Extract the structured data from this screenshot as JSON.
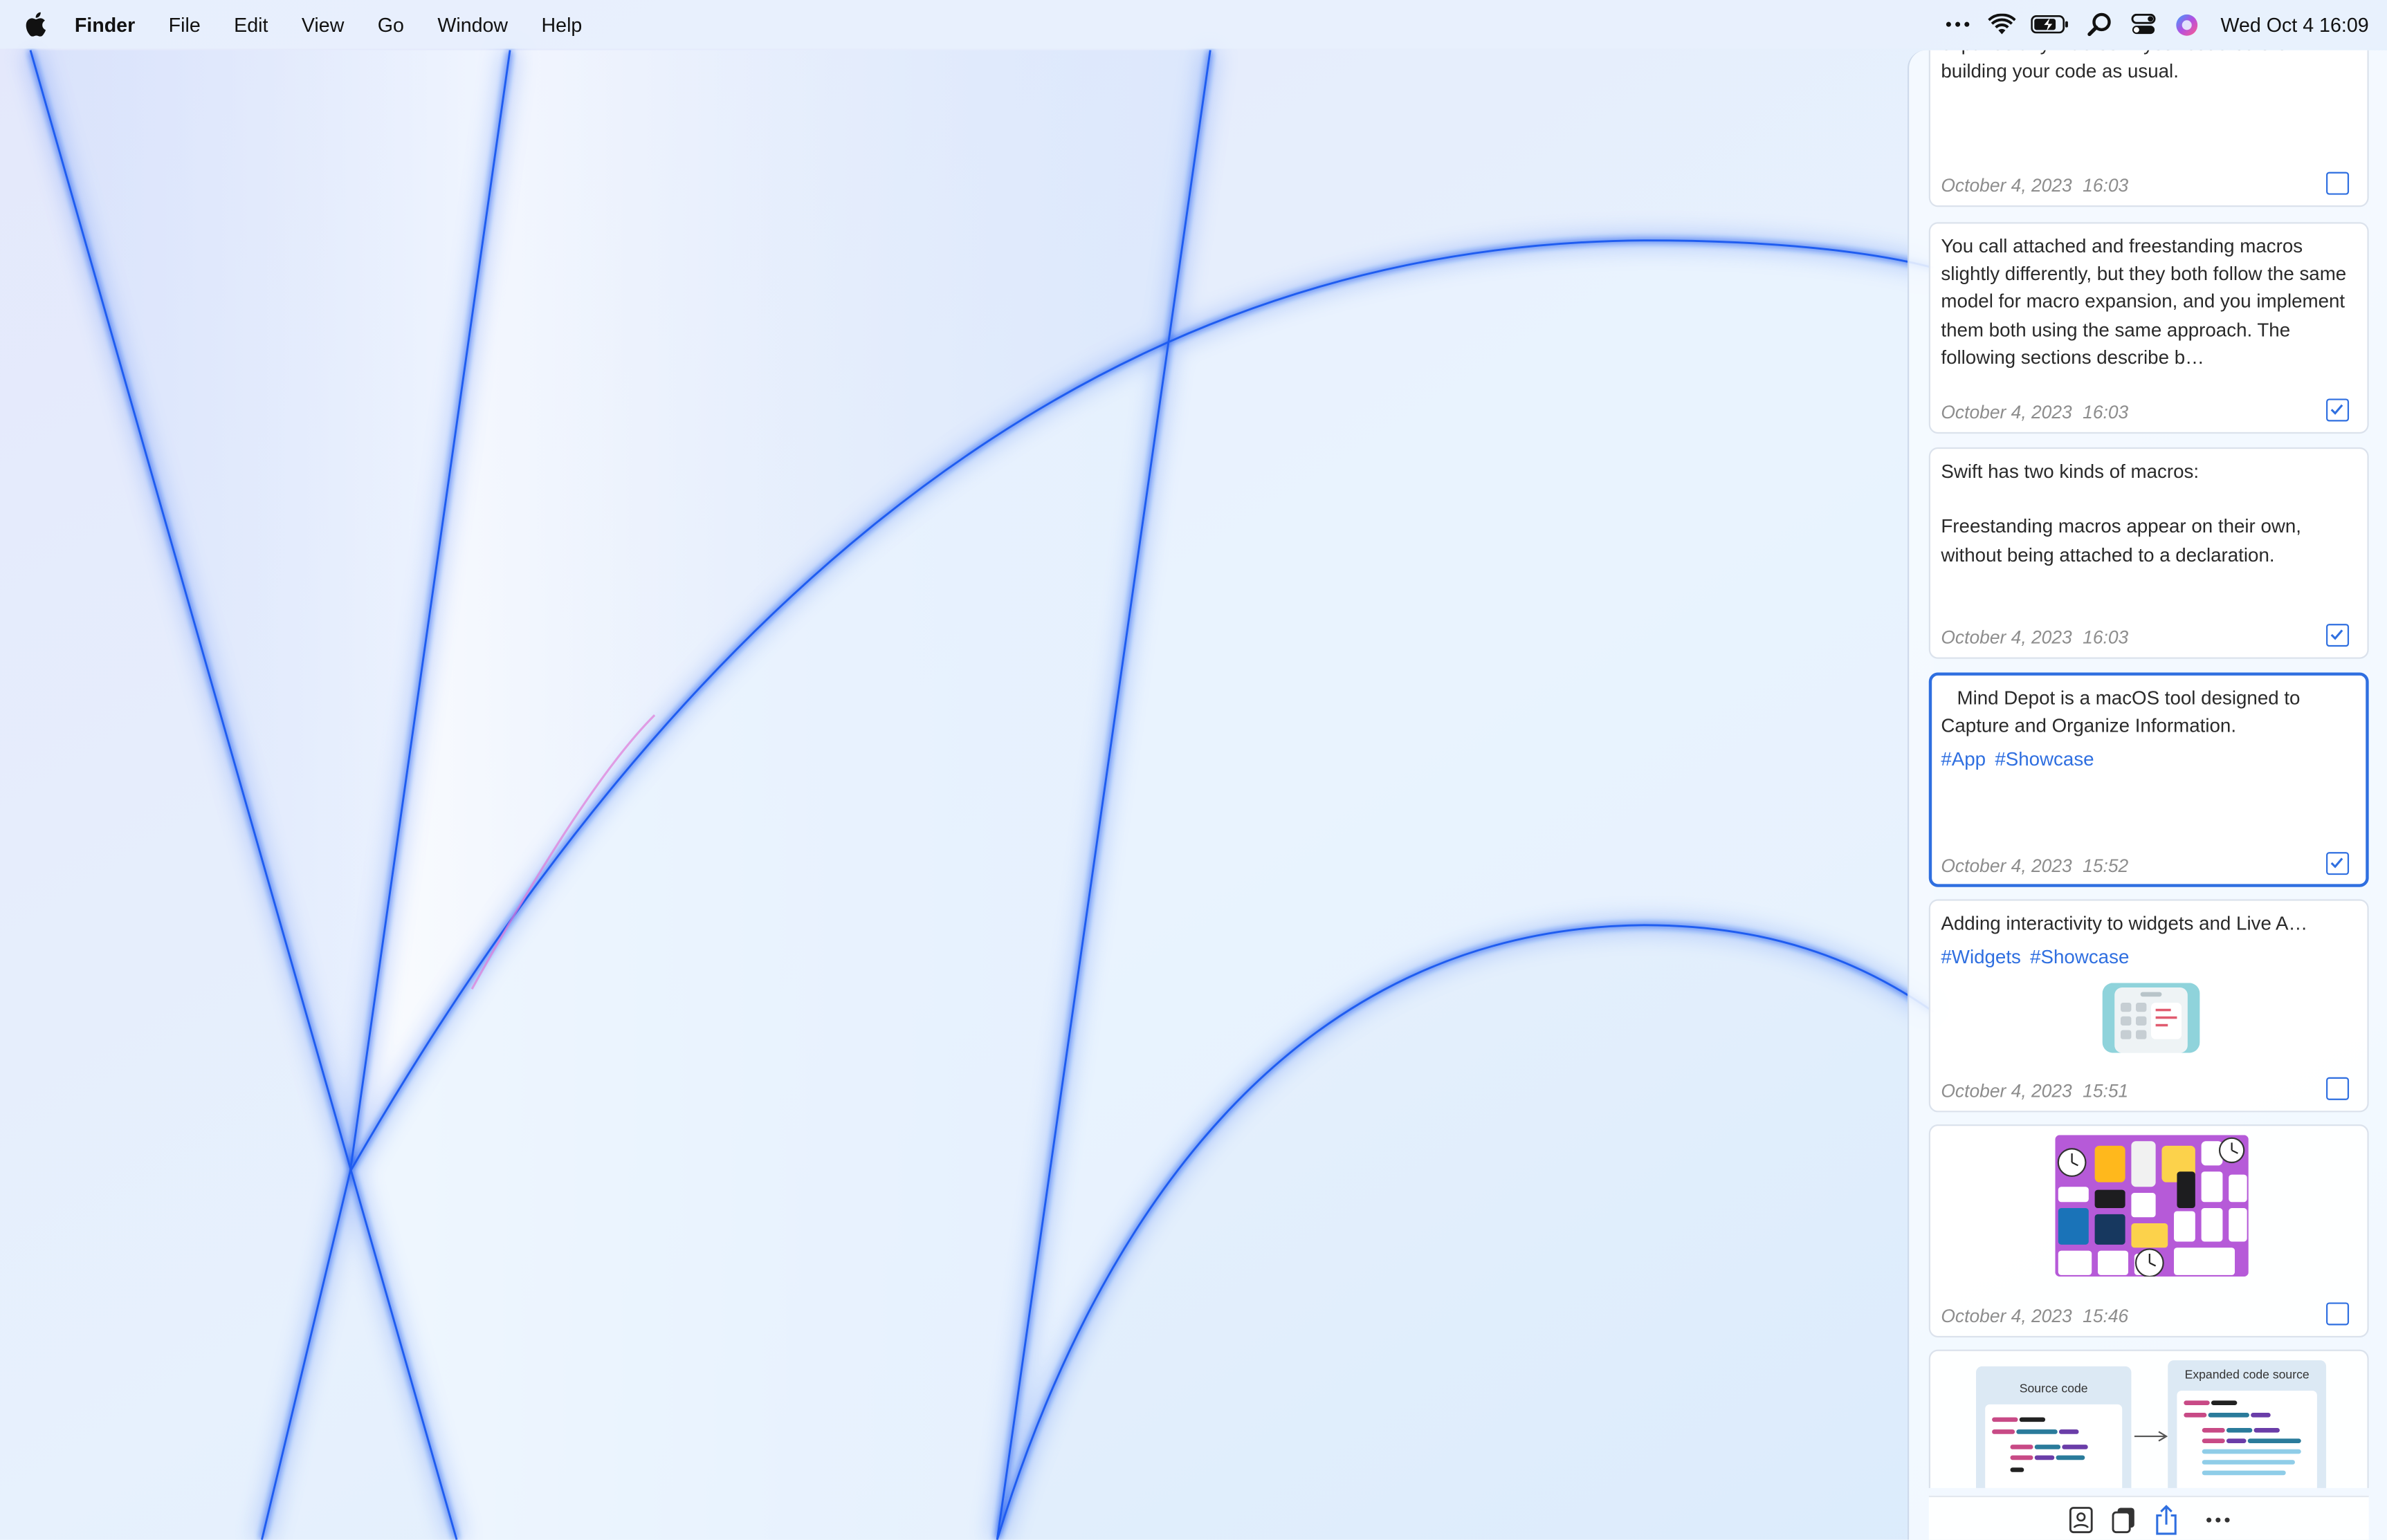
{
  "menubar": {
    "apple_icon": "apple-logo-icon",
    "app_name": "Finder",
    "menus": [
      "File",
      "Edit",
      "View",
      "Go",
      "Window",
      "Help"
    ],
    "status_icons": [
      "more-icon",
      "wifi-icon",
      "battery-icon",
      "spotlight-icon",
      "control-center-icon",
      "siri-icon"
    ],
    "clock": "Wed Oct 4  16:09"
  },
  "panel": {
    "cards": [
      {
        "text": "code by hand. During compilation, Swift expands any macros in your code before building your code as usual.",
        "date": "October 4, 2023",
        "time": "16:03",
        "checked": false
      },
      {
        "text": "You call attached and freestanding macros slightly differently, but they both follow the same model for macro expansion, and you implement them both using the same approach. The following sections describe b…",
        "date": "October 4, 2023",
        "time": "16:03",
        "checked": true
      },
      {
        "text": "Swift has two kinds of macros:\n\nFreestanding macros appear on their own, without being attached to a declaration.",
        "date": "October 4, 2023",
        "time": "16:03",
        "checked": true
      },
      {
        "text": "   Mind Depot is a macOS tool designed to Capture and Organize Information.",
        "tags": [
          "#App",
          "#Showcase"
        ],
        "date": "October 4, 2023",
        "time": "15:52",
        "checked": true,
        "selected": true
      },
      {
        "text": "    Adding interactivity to widgets and Live A…",
        "tags": [
          "#Widgets",
          "#Showcase"
        ],
        "image": "widget-phone-thumbnail",
        "date": "October 4, 2023",
        "time": "15:51",
        "checked": false
      },
      {
        "image": "widgets-gallery-thumbnail",
        "date": "October 4, 2023",
        "time": "15:46",
        "checked": false
      },
      {
        "image": "macro-expansion-diagram",
        "diagram_labels": [
          "Source code",
          "Expanded code source"
        ]
      }
    ]
  },
  "toolbar": {
    "buttons": [
      "contact-card-icon",
      "copy-icon",
      "share-icon",
      "more-icon"
    ]
  },
  "colors": {
    "accent": "#2f6fe0",
    "wallpaper_stroke": "#1f5cf0"
  }
}
